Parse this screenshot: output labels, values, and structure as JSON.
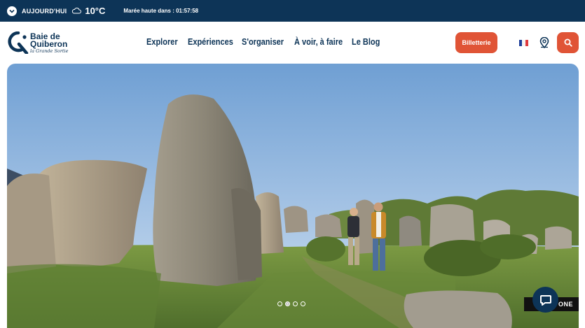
{
  "topbar": {
    "today_label": "AUJOURD'HUI",
    "weather_icon": "cloud-icon",
    "temperature": "10°C",
    "tide_label": "Marée haute dans : ",
    "tide_countdown": "01:57:58"
  },
  "logo": {
    "line1": "Baie de",
    "line2": "Quiberon",
    "tagline": "la Grande Sortie"
  },
  "nav": {
    "items": [
      "Explorer",
      "Expériences",
      "S'organiser",
      "À voir, à faire",
      "Le Blog"
    ]
  },
  "actions": {
    "ticket_label": "Billetterie",
    "language": "fr-flag-icon",
    "map_icon": "map-pin-icon",
    "search_icon": "search-icon"
  },
  "hero": {
    "slide_count": 4,
    "active_slide": 2
  },
  "widget": {
    "badge_text": "ONE"
  },
  "colors": {
    "navy": "#0d3457",
    "accent": "#e05436"
  }
}
